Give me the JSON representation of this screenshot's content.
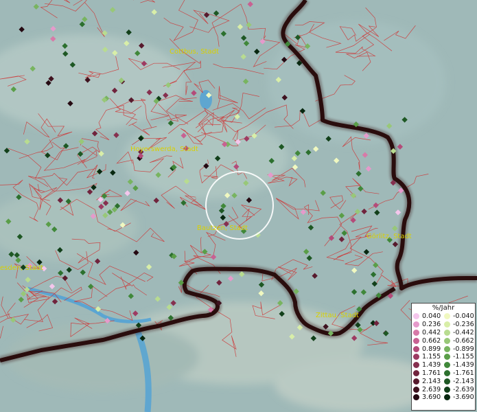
{
  "map": {
    "cities": [
      {
        "name": "Cottbus, Stadt"
      },
      {
        "name": "Hoyerswerda, Stadt"
      },
      {
        "name": "Bautzen, Stadt"
      },
      {
        "name": "Görlitz, Stadt"
      },
      {
        "name": "Zittau, Stadt"
      },
      {
        "name": "esden, Stadt"
      }
    ],
    "colors": {
      "border": "#2a0d0d",
      "district_lines": "#d03030",
      "water": "#4aa0d8",
      "terrain_light": "#c8d8d0",
      "terrain_base": "#9fb9b8",
      "highlight_circle": "#ffffff"
    }
  },
  "legend": {
    "title": "%/Jahr",
    "positive": [
      {
        "label": "0.040",
        "color": "#f4c6ec"
      },
      {
        "label": "0.236",
        "color": "#e59acb"
      },
      {
        "label": "0.442",
        "color": "#d77aa8"
      },
      {
        "label": "0.662",
        "color": "#c86192"
      },
      {
        "label": "0.899",
        "color": "#b44b79"
      },
      {
        "label": "1.155",
        "color": "#9e3b62"
      },
      {
        "label": "1.439",
        "color": "#86304f"
      },
      {
        "label": "1.761",
        "color": "#70243d"
      },
      {
        "label": "2.143",
        "color": "#571a2d"
      },
      {
        "label": "2.639",
        "color": "#3f121f"
      },
      {
        "label": "3.690",
        "color": "#250a12"
      }
    ],
    "negative": [
      {
        "label": "-0.040",
        "color": "#f0f8c0"
      },
      {
        "label": "-0.236",
        "color": "#d8eea8"
      },
      {
        "label": "-0.442",
        "color": "#b8dc90"
      },
      {
        "label": "-0.662",
        "color": "#98c878"
      },
      {
        "label": "-0.899",
        "color": "#78b460"
      },
      {
        "label": "-1.155",
        "color": "#5a9e48"
      },
      {
        "label": "-1.439",
        "color": "#40883a"
      },
      {
        "label": "-1.761",
        "color": "#2c702e"
      },
      {
        "label": "-2.143",
        "color": "#1e5824"
      },
      {
        "label": "-2.639",
        "color": "#12401a"
      },
      {
        "label": "-3.690",
        "color": "#082810"
      }
    ]
  }
}
